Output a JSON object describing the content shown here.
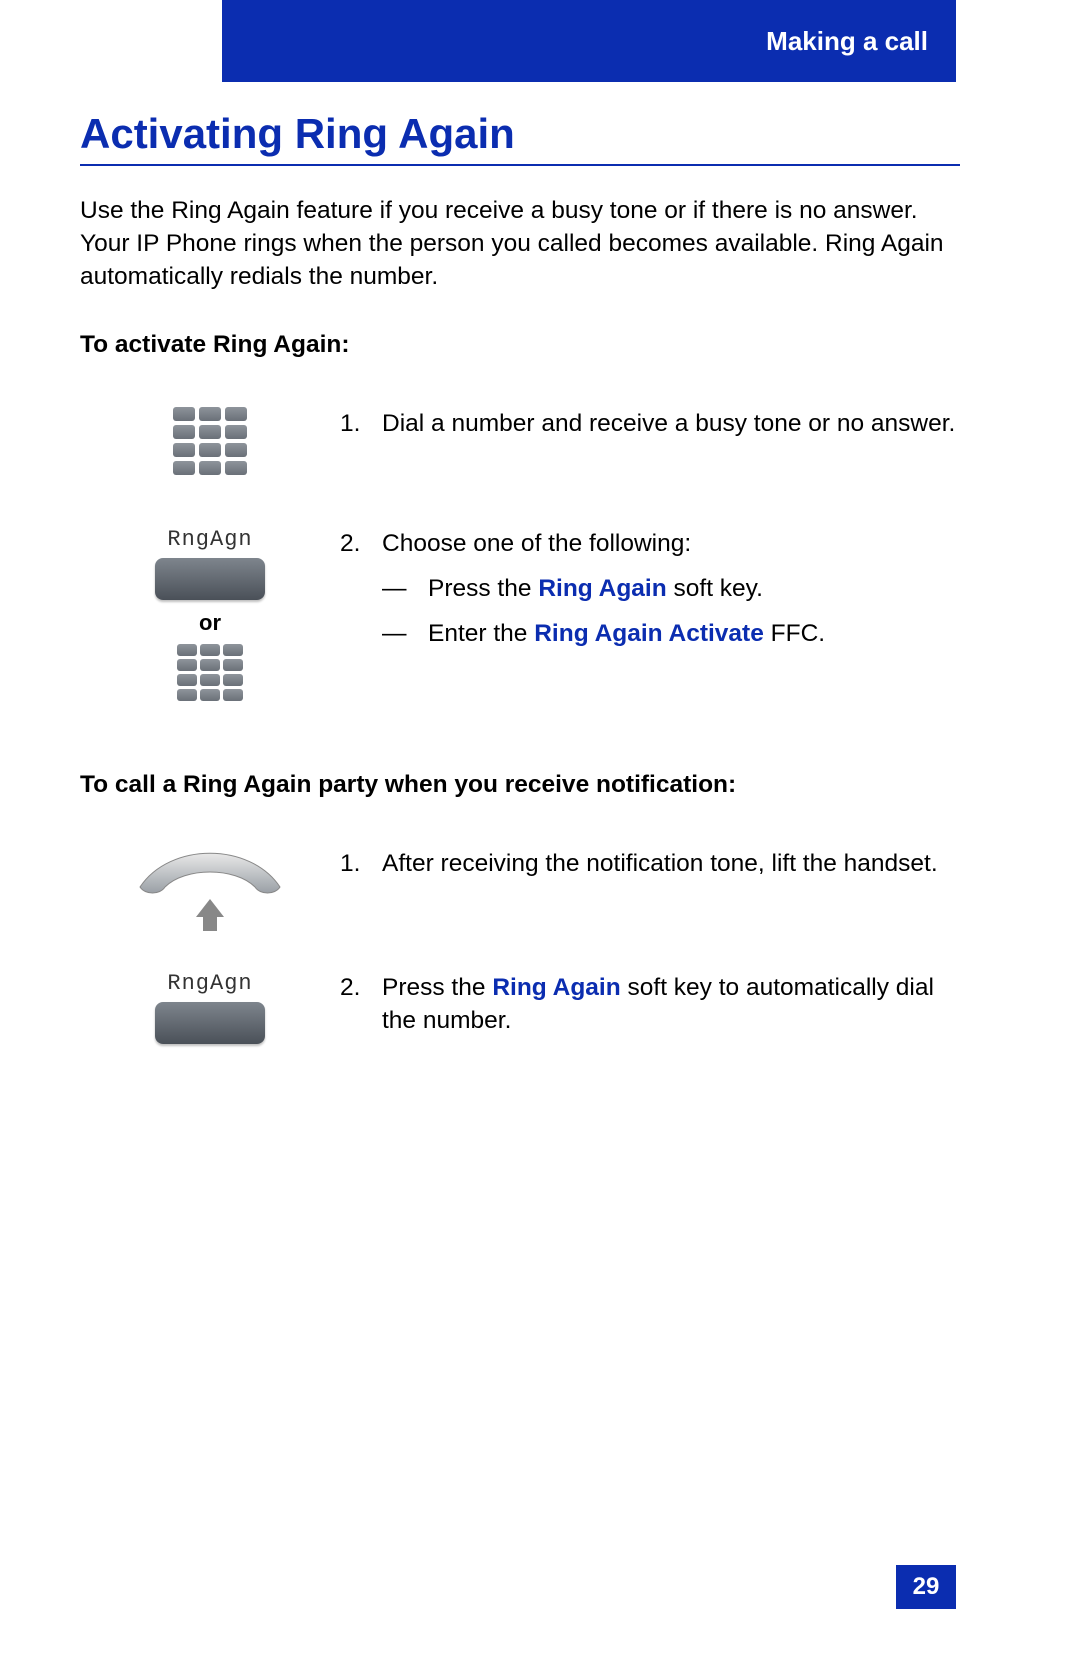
{
  "header": {
    "section": "Making a call"
  },
  "title": "Activating Ring Again",
  "intro": "Use the Ring Again feature if you receive a busy tone or if there is no answer. Your IP Phone rings when the person you called becomes available. Ring Again automatically redials the number.",
  "section1": {
    "heading": "To activate Ring Again:",
    "step1": {
      "num": "1.",
      "text": "Dial a number and receive a busy tone or no answer."
    },
    "step2": {
      "num": "2.",
      "lead": "Choose one of the following:",
      "dash": "—",
      "opt1_pre": "Press the ",
      "opt1_kw": "Ring Again",
      "opt1_post": " soft key.",
      "opt2_pre": "Enter the ",
      "opt2_kw": "Ring Again Activate",
      "opt2_post": " FFC."
    },
    "softkey_label": "RngAgn",
    "or": "or"
  },
  "section2": {
    "heading": "To call a Ring Again party when you receive notification:",
    "step1": {
      "num": "1.",
      "text": "After receiving the notification tone, lift the handset."
    },
    "step2": {
      "num": "2.",
      "pre": "Press the ",
      "kw": "Ring Again",
      "post": " soft key to automatically dial the number."
    },
    "softkey_label": "RngAgn"
  },
  "page_number": "29"
}
